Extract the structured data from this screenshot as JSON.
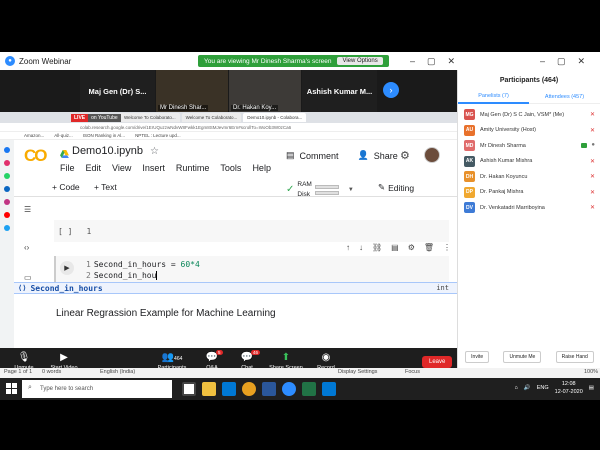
{
  "zoom": {
    "window_title": "Zoom Webinar",
    "share_banner": "You are viewing Mr Dinesh Sharma's screen",
    "view_options": "View Options"
  },
  "video_strip": {
    "tiles": [
      {
        "label": "Maj Gen (Dr) S..."
      },
      {
        "label": "Mr Dinesh Shar..."
      },
      {
        "label": "Dr. Hakan Koy..."
      },
      {
        "label": "Ashish Kumar M..."
      }
    ]
  },
  "participants": {
    "title": "Participants (464)",
    "tab_panelists": "Panelists (7)",
    "tab_attendees": "Attendees (457)",
    "people": [
      {
        "initials": "MG",
        "name": "Maj Gen (Dr) S C Jain, VSM* (Me)",
        "color": "#d9534f"
      },
      {
        "initials": "AU",
        "name": "Amity University (Host)",
        "color": "#e8712b"
      },
      {
        "initials": "MD",
        "name": "Mr Dinesh Sharma",
        "color": "#e06b6b"
      },
      {
        "initials": "AK",
        "name": "Ashish Kumar Mishra",
        "color": "#455a64"
      },
      {
        "initials": "DH",
        "name": "Dr. Hakan Koyuncu",
        "color": "#e8912b"
      },
      {
        "initials": "DP",
        "name": "Dr. Pankaj Mishra",
        "color": "#f0a830"
      },
      {
        "initials": "DV",
        "name": "Dr. Venkatadri Marriboyina",
        "color": "#3e7bd6"
      }
    ],
    "invite": "Invite",
    "unmute_me": "Unmute Me",
    "raise_hand": "Raise Hand"
  },
  "browser": {
    "live_label": "LIVE",
    "live_sub": "on YouTube",
    "tabs": [
      "Welcome To Colaborato...",
      "Welcome To Colaborato...",
      "Demo10.ipynb - Colabora..."
    ],
    "address": "colab.research.google.com/drive/1ErUQuzzwNdvW8Fwkk1Egm8SMJevmr6Ern#scrollTo=WoOb3W0zCa6",
    "bookmarks": [
      "Amazon...",
      "All-quiz...",
      "ISON Ranking in Al...",
      "NPTEL : Lecture upd..."
    ]
  },
  "colab": {
    "logo": "CO",
    "notebook_title": "Demo10.ipynb",
    "menu": [
      "File",
      "Edit",
      "View",
      "Insert",
      "Runtime",
      "Tools",
      "Help"
    ],
    "comment_label": "Comment",
    "share_label": "Share",
    "add_code": "+ Code",
    "add_text": "+ Text",
    "ram_label": "RAM",
    "disk_label": "Disk",
    "editing_label": "Editing",
    "cell1_brackets": "[ ]",
    "cell1_line": "1",
    "cell2_line1_num": "1",
    "cell2_line1_var": "Second_in_hours",
    "cell2_line1_op": " = ",
    "cell2_line1_val": "60*4",
    "cell2_line2_num": "2",
    "cell2_line2_text": "Second_in_hou",
    "autocomplete_item": "Second_in_hours",
    "autocomplete_type": "int",
    "heading": "Linear Regrassion Example for Machine Learning"
  },
  "controls": {
    "unmute": "Unmute",
    "start_video": "Start Video",
    "participants_count": "464",
    "participants": "Participants",
    "qa_badge": "5",
    "qa": "Q&A",
    "chat_badge": "46",
    "chat": "Chat",
    "share_screen": "Share Screen",
    "record": "Record",
    "leave": "Leave"
  },
  "word_status": {
    "page": "Page 1 of 1",
    "words": "0 words",
    "lang": "English (India)",
    "display": "Display Settings",
    "focus": "Focus",
    "zoom_pct": "100%"
  },
  "taskbar": {
    "search_placeholder": "Type here to search",
    "lang": "ENG",
    "time": "12:08",
    "date": "12-07-2020"
  }
}
